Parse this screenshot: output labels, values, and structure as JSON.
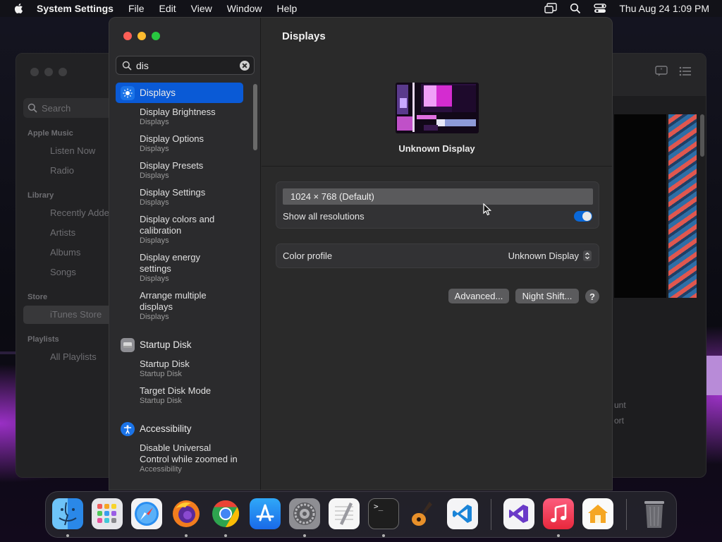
{
  "menubar": {
    "app_name": "System Settings",
    "menus": [
      "File",
      "Edit",
      "View",
      "Window",
      "Help"
    ],
    "clock": "Thu Aug 24  1:09 PM"
  },
  "music_window": {
    "search_placeholder": "Search",
    "sections": [
      {
        "title": "Apple Music",
        "items": [
          "Listen Now",
          "Radio"
        ]
      },
      {
        "title": "Library",
        "items": [
          "Recently Added",
          "Artists",
          "Albums",
          "Songs"
        ]
      },
      {
        "title": "Store",
        "items": [
          "iTunes Store"
        ]
      },
      {
        "title": "Playlists",
        "items": [
          "All Playlists"
        ]
      }
    ],
    "right_fragments": [
      "unt",
      "ort"
    ]
  },
  "settings": {
    "search_value": "dis",
    "results": [
      {
        "kind": "head",
        "label": "Displays",
        "active": true,
        "icon": "displays-icon",
        "icon_color": "#1a73e8"
      },
      {
        "kind": "sub",
        "label": "Display Brightness",
        "category": "Displays"
      },
      {
        "kind": "sub",
        "label": "Display Options",
        "category": "Displays"
      },
      {
        "kind": "sub",
        "label": "Display Presets",
        "category": "Displays"
      },
      {
        "kind": "sub",
        "label": "Display Settings",
        "category": "Displays"
      },
      {
        "kind": "sub",
        "label": "Display colors and calibration",
        "category": "Displays"
      },
      {
        "kind": "sub",
        "label": "Display energy settings",
        "category": "Displays"
      },
      {
        "kind": "sub",
        "label": "Arrange multiple displays",
        "category": "Displays"
      },
      {
        "kind": "head",
        "label": "Startup Disk",
        "active": false,
        "icon": "startup-disk-icon",
        "icon_color": "#8e8e93"
      },
      {
        "kind": "sub",
        "label": "Startup Disk",
        "category": "Startup Disk"
      },
      {
        "kind": "sub",
        "label": "Target Disk Mode",
        "category": "Startup Disk"
      },
      {
        "kind": "head",
        "label": "Accessibility",
        "active": false,
        "icon": "accessibility-icon",
        "icon_color": "#1a73e8"
      },
      {
        "kind": "sub",
        "label": "Disable Universal Control while zoomed in",
        "category": "Accessibility"
      }
    ],
    "main": {
      "title": "Displays",
      "display_name": "Unknown Display",
      "resolution": "1024 × 768 (Default)",
      "show_all_resolutions_label": "Show all resolutions",
      "show_all_resolutions_on": true,
      "color_profile_label": "Color profile",
      "color_profile_value": "Unknown Display",
      "advanced_button": "Advanced...",
      "night_shift_button": "Night Shift...",
      "help_button": "?"
    }
  },
  "dock": {
    "apps": [
      {
        "name": "Finder",
        "icon": "finder-icon",
        "running": true
      },
      {
        "name": "Launchpad",
        "icon": "launchpad-icon",
        "running": false
      },
      {
        "name": "Safari",
        "icon": "safari-icon",
        "running": false
      },
      {
        "name": "Firefox",
        "icon": "firefox-icon",
        "running": true
      },
      {
        "name": "Chrome",
        "icon": "chrome-icon",
        "running": true
      },
      {
        "name": "App Store",
        "icon": "app-store-icon",
        "running": false
      },
      {
        "name": "System Settings",
        "icon": "system-settings-icon",
        "running": true
      },
      {
        "name": "TextEdit",
        "icon": "textedit-icon",
        "running": false
      },
      {
        "name": "Terminal",
        "icon": "terminal-icon",
        "running": true
      },
      {
        "name": "GarageBand",
        "icon": "garageband-icon",
        "running": false
      },
      {
        "name": "Visual Studio Code",
        "icon": "vscode-icon",
        "running": false
      },
      {
        "name": "Visual Studio",
        "icon": "visual-studio-icon",
        "running": false
      },
      {
        "name": "Music",
        "icon": "music-icon",
        "running": true
      },
      {
        "name": "Home",
        "icon": "home-icon",
        "running": false
      },
      {
        "name": "Trash",
        "icon": "trash-icon",
        "running": false
      }
    ],
    "terminal_glyph": ">_"
  }
}
